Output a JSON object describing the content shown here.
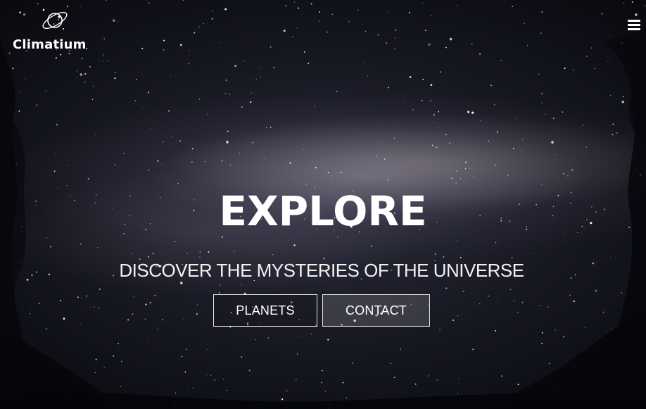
{
  "brand": {
    "name": "Climatium",
    "logo_icon": "planet-ring-icon"
  },
  "nav": {
    "menu_icon": "hamburger-menu-icon"
  },
  "hero": {
    "title": "EXPLORE",
    "subtitle": "DISCOVER THE MYSTERIES OF THE UNIVERSE",
    "buttons": {
      "planets": "PLANETS",
      "contact": "CONTACT"
    }
  },
  "colors": {
    "text": "#ffffff",
    "background": "#05060b",
    "button_border": "#e8e8e8"
  }
}
